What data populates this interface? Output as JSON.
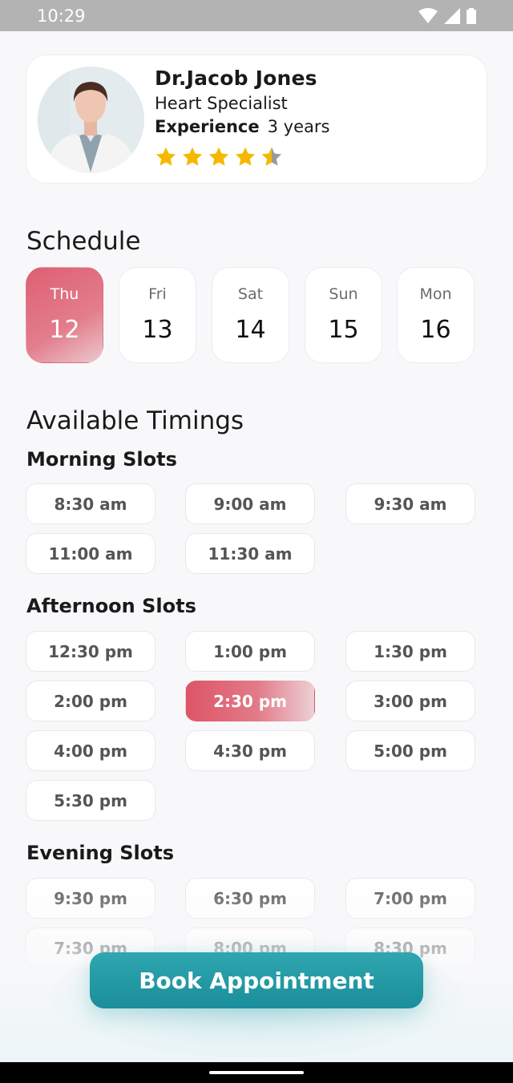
{
  "status_bar": {
    "time": "10:29"
  },
  "doctor": {
    "name": "Dr.Jacob Jones",
    "specialty": "Heart Specialist",
    "experience_label": "Experience",
    "experience_value": "3 years",
    "rating": 4.5
  },
  "schedule": {
    "title": "Schedule",
    "days": [
      {
        "day": "Thu",
        "date": "12",
        "selected": true
      },
      {
        "day": "Fri",
        "date": "13",
        "selected": false
      },
      {
        "day": "Sat",
        "date": "14",
        "selected": false
      },
      {
        "day": "Sun",
        "date": "15",
        "selected": false
      },
      {
        "day": "Mon",
        "date": "16",
        "selected": false
      }
    ]
  },
  "timings": {
    "title": "Available Timings",
    "morning": {
      "label": "Morning Slots",
      "slots": [
        "8:30 am",
        "9:00 am",
        "9:30 am",
        "11:00 am",
        "11:30 am"
      ]
    },
    "afternoon": {
      "label": "Afternoon Slots",
      "slots": [
        "12:30 pm",
        "1:00 pm",
        "1:30 pm",
        "2:00 pm",
        "2:30 pm",
        "3:00 pm",
        "4:00 pm",
        "4:30 pm",
        "5:00 pm",
        "5:30 pm"
      ],
      "selected": "2:30 pm"
    },
    "evening": {
      "label": "Evening Slots",
      "slots": [
        "9:30 pm",
        "6:30 pm",
        "7:00 pm",
        "7:30 pm",
        "8:00 pm",
        "8:30 pm"
      ]
    }
  },
  "actions": {
    "book_label": "Book Appointment"
  },
  "colors": {
    "accent_selected": "#de5f72",
    "primary_button": "#1f96a2",
    "star": "#f5b800"
  }
}
